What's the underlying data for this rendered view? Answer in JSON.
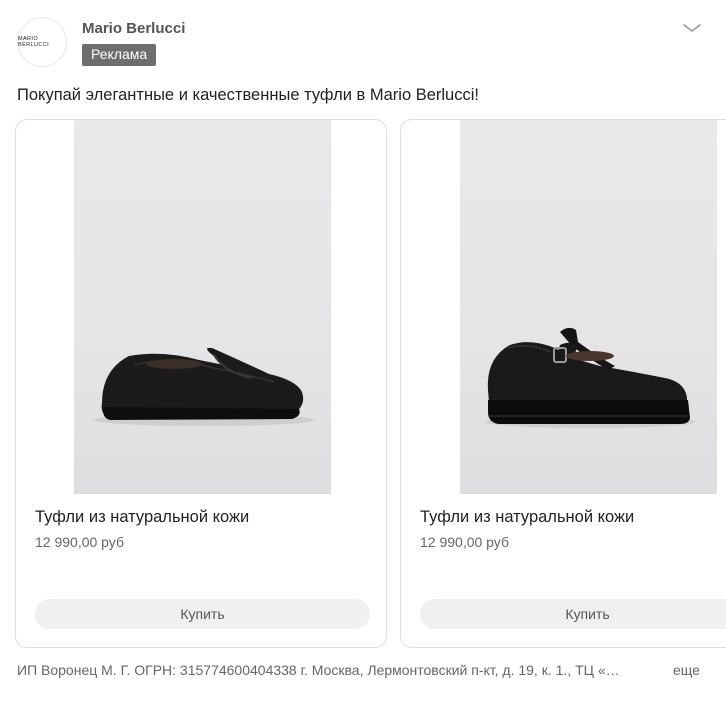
{
  "post": {
    "brand_name": "Mario Berlucci",
    "avatar_text": "MARIO BERLUCCI",
    "ad_label": "Реклама",
    "text": "Покупай элегантные и качественные туфли в Mario Berlucci!",
    "menu_icon": "chevron-down-icon"
  },
  "products": [
    {
      "title": "Туфли из натуральной кожи",
      "price": "12 990,00 руб",
      "button_label": "Купить",
      "image": "black-leather-loafer"
    },
    {
      "title": "Туфли из натуральной кожи",
      "price": "12 990,00 руб",
      "button_label": "Купить",
      "image": "black-leather-mary-jane-platform"
    }
  ],
  "footer": {
    "legal": "ИП Воронец М. Г. ОГРН: 315774600404338 г. Москва, Лермонтовский п-кт, д. 19, к. 1., ТЦ «…",
    "more_label": "еще"
  },
  "colors": {
    "badge_bg": "#6e6e6e",
    "button_bg": "#f0f0f0",
    "card_border": "#dedede"
  }
}
